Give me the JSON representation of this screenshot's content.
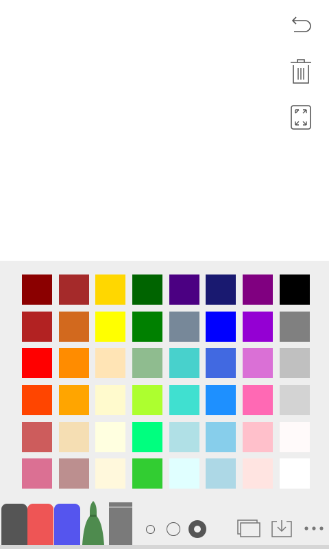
{
  "toolbar_right": {
    "undo_icon": "undo-icon",
    "trash_icon": "trash-icon",
    "fullscreen_icon": "expand-icon"
  },
  "palette": {
    "colors": [
      "#8B0000",
      "#A52A2A",
      "#FFD700",
      "#006400",
      "#4B0082",
      "#191970",
      "#800080",
      "#000000",
      "#B22222",
      "#D2691E",
      "#FFFF00",
      "#008000",
      "#778899",
      "#0000FF",
      "#9400D3",
      "#808080",
      "#FF0000",
      "#FF8C00",
      "#FFE4B5",
      "#8FBC8F",
      "#48D1CC",
      "#4169E1",
      "#DA70D6",
      "#C0C0C0",
      "#FF4500",
      "#FFA500",
      "#FFFACD",
      "#ADFF2F",
      "#40E0D0",
      "#1E90FF",
      "#FF69B4",
      "#D3D3D3",
      "#CD5C5C",
      "#F5DEB3",
      "#FFFFE0",
      "#00FF7F",
      "#B0E0E6",
      "#87CEEB",
      "#FFC0CB",
      "#FFFAFA",
      "#DB7093",
      "#BC8F8F",
      "#FFF8DC",
      "#32CD32",
      "#E0FFFF",
      "#ADD8E6",
      "#FFE4E1",
      "#FFFFFF"
    ]
  },
  "tools": {
    "marker_dark_color": "#555555",
    "marker_red_color": "#EE5555",
    "marker_blue_color": "#5555EE",
    "brush_color": "#4E8B4E",
    "eraser_color": "#7A7A7A",
    "selected_size": "large"
  },
  "bottom_icons": {
    "layers": "layers-icon",
    "save": "download-icon",
    "more": "more-icon"
  }
}
